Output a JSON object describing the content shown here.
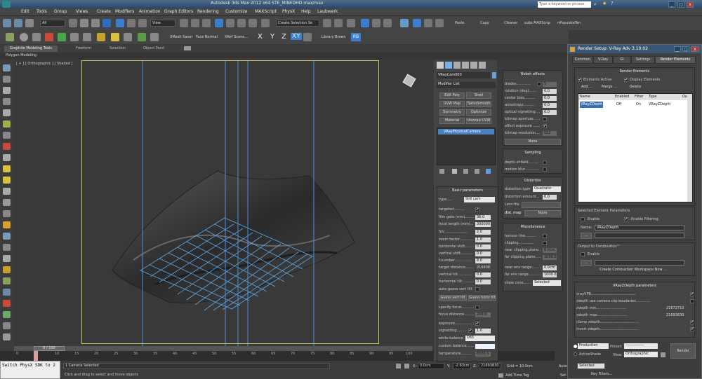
{
  "window": {
    "title": "Autodesk 3ds Max 2012 x64     STE_MINEDHD.max/max",
    "search_placeholder": "Type a keyword or phrase",
    "min": "_",
    "max": "□",
    "close": "x"
  },
  "menu": [
    "Edit",
    "Tools",
    "Group",
    "Views",
    "Create",
    "Modifiers",
    "Animation",
    "Graph Editors",
    "Rendering",
    "Customize",
    "MAXScript",
    "PhysX",
    "Help",
    "Laubwerk"
  ],
  "toolbar": {
    "selection_filter": "All",
    "ref_coord": "View",
    "named_sel": "Create Selection Se",
    "paste": "Paste",
    "copy": "Copy",
    "cleaner": "Cleaner",
    "subs": "subs MAXScrip",
    "populate": "nPopulateTen"
  },
  "toolbar2": {
    "xmesh": "XMesh Saver",
    "face": "Face Normal",
    "xref": "XRef Scene...",
    "x": "X",
    "y": "Y",
    "z": "Z",
    "xy": "XY",
    "lib": "Library Brows",
    "rb": "RB"
  },
  "ribbon": {
    "tabs": [
      "Graphite Modeling Tools",
      "Freeform",
      "Selection",
      "Object Paint"
    ],
    "sub": "Polygon Modeling"
  },
  "viewport": {
    "label": "[ + ] [ Orthographic ] [ Shaded ]"
  },
  "timeline": {
    "frame": "0 / 100",
    "ticks": [
      "0",
      "5",
      "10",
      "15",
      "20",
      "25",
      "30",
      "35",
      "40",
      "45",
      "50",
      "55",
      "60",
      "65",
      "70",
      "75",
      "80",
      "85",
      "90",
      "95",
      "100"
    ]
  },
  "status": {
    "maxscript": "Switch PhysX SDK to 2",
    "selected": "1 Camera Selected",
    "prompt": "Click and drag to select and move objects",
    "x_label": "X:",
    "x": "0.0cm",
    "y_label": "Y:",
    "y": "-2.63cm",
    "z_label": "Z:",
    "z": "21693830.",
    "grid": "Grid = 10.0cm",
    "add_time_tag": "Add Time Tag",
    "auto_key": "Auto Key",
    "set_key": "Set Key",
    "key_mode": "Selected",
    "key_filters": "Key Filters..."
  },
  "cmd": {
    "object_name": "VRayCam003",
    "modifier_list": "Modifier List",
    "buttons": [
      "Edit Poly",
      "Shell",
      "UVW Map",
      "TurboSmooth",
      "Symmetry",
      "Optimize",
      "Material",
      "Unwrap UVW"
    ],
    "stack_item": "VRayPhysicalCamera"
  },
  "basic": {
    "title": "Basic parameters",
    "type_label": "type......",
    "type": "Still cam",
    "targeted": "targeted..........",
    "rows": [
      {
        "l": "film gate (mm)........",
        "v": "36.0"
      },
      {
        "l": "focal length (mm).......",
        "v": "300000"
      },
      {
        "l": "fov.....................",
        "v": "2.0"
      },
      {
        "l": "zoom factor.............",
        "v": "1.0"
      },
      {
        "l": "horizontal shift.........",
        "v": "0.0"
      },
      {
        "l": "vertical shift...........",
        "v": "0.0"
      },
      {
        "l": "f-number................",
        "v": "8.0"
      },
      {
        "l": "target distance..........",
        "v": "21693830"
      },
      {
        "l": "vertical tilt.............",
        "v": "0.0"
      },
      {
        "l": "horizontal tilt...........",
        "v": "0.0"
      }
    ],
    "auto_guess": "auto guess vert tilt",
    "guess_vert": "Guess vert tilt",
    "guess_horiz": "Guess horiz tilt",
    "specify_focus": "specify focus............",
    "focus_distance": "focus distance...........",
    "focus_val": "200.0",
    "exposure": "exposure..................",
    "vignetting": "vignetting...........",
    "vig_val": "1.0",
    "wb_label": "white balance",
    "wb": "D65",
    "custom_balance": "custom balance .........",
    "temperature": "temperature..........",
    "temp_val": "6500.0"
  },
  "bokeh": {
    "title": "Bokeh effects",
    "rows": [
      {
        "l": "blades.............",
        "v": "5"
      },
      {
        "l": "rotation (deg).......",
        "v": "0.0"
      },
      {
        "l": "center bias..........",
        "v": "0.0"
      },
      {
        "l": "anisotropy...........",
        "v": "0.0"
      },
      {
        "l": "optical vignetting ......",
        "v": "0.0"
      }
    ],
    "aperture": "bitmap aperture ........",
    "affect": "affect exposure ........",
    "resolution": "bitmap resolution......",
    "res_val": "512",
    "none": "None"
  },
  "sampling": {
    "title": "Sampling",
    "dof": "depth-of-field.........",
    "motion": "motion blur............."
  },
  "distortion": {
    "title": "Distortion",
    "type_label": "distortion type",
    "type": "Quadratic",
    "amount": "distortion amount....",
    "amount_val": "0.0",
    "lens": "Lens file",
    "map_label": "dist. map",
    "none": "None"
  },
  "misc": {
    "title": "Miscellaneous",
    "horizon": "horizon line..........",
    "clipping": "clipping..............",
    "near_clip": "near clipping plane......",
    "near_val": "0.0cm",
    "far_clip": "far clipping plane.......",
    "far_val": "1000.0",
    "near_env": "near env range..........",
    "near_env_val": "0.0cm",
    "far_env": "far env range...........",
    "far_env_val": "1000.0",
    "show_cone": "show cone..............",
    "cone": "Selected"
  },
  "render_setup": {
    "title": "Render Setup: V-Ray Adv 3.10.02",
    "tabs": [
      "Common",
      "V-Ray",
      "GI",
      "Settings",
      "Render Elements"
    ],
    "elements_title": "Render Elements",
    "elements_active": "Elements Active",
    "display_elements": "Display Elements",
    "add": "Add ...",
    "merge": "Merge ...",
    "delete": "Delete",
    "cols": [
      "Name",
      "Enabled",
      "Filter",
      "Type",
      "Ou"
    ],
    "row": [
      "VRayZDepth",
      "Off",
      "On",
      "VRayZDepth"
    ],
    "selected_title": "Selected Element Parameters",
    "enable": "Enable",
    "enable_filtering": "Enable Filtering",
    "name_label": "Name:",
    "name": "VRayZDepth",
    "combustion": "Output to Combustion™",
    "comb_enable": "Enable",
    "create_ws": "Create Combustion Workspace Now ...",
    "zdepth_title": "VRayZDepth parameters",
    "zrows": [
      {
        "l": "vrayVFB........................................",
        "v": ""
      },
      {
        "l": "zdepth use camera clip boudaries.............",
        "v": ""
      },
      {
        "l": "zdepth min...........................",
        "v": "21672710"
      },
      {
        "l": "zdepth max...........................",
        "v": "21693830"
      },
      {
        "l": "clamp zdepth...................................",
        "v": ""
      },
      {
        "l": "invert zdepth...................................",
        "v": ""
      }
    ],
    "production": "Production",
    "activeshade": "ActiveShade",
    "preset": "Preset:",
    "preset_val": "---------------",
    "view": "View:",
    "view_val": "Orthographic",
    "render": "Render"
  }
}
